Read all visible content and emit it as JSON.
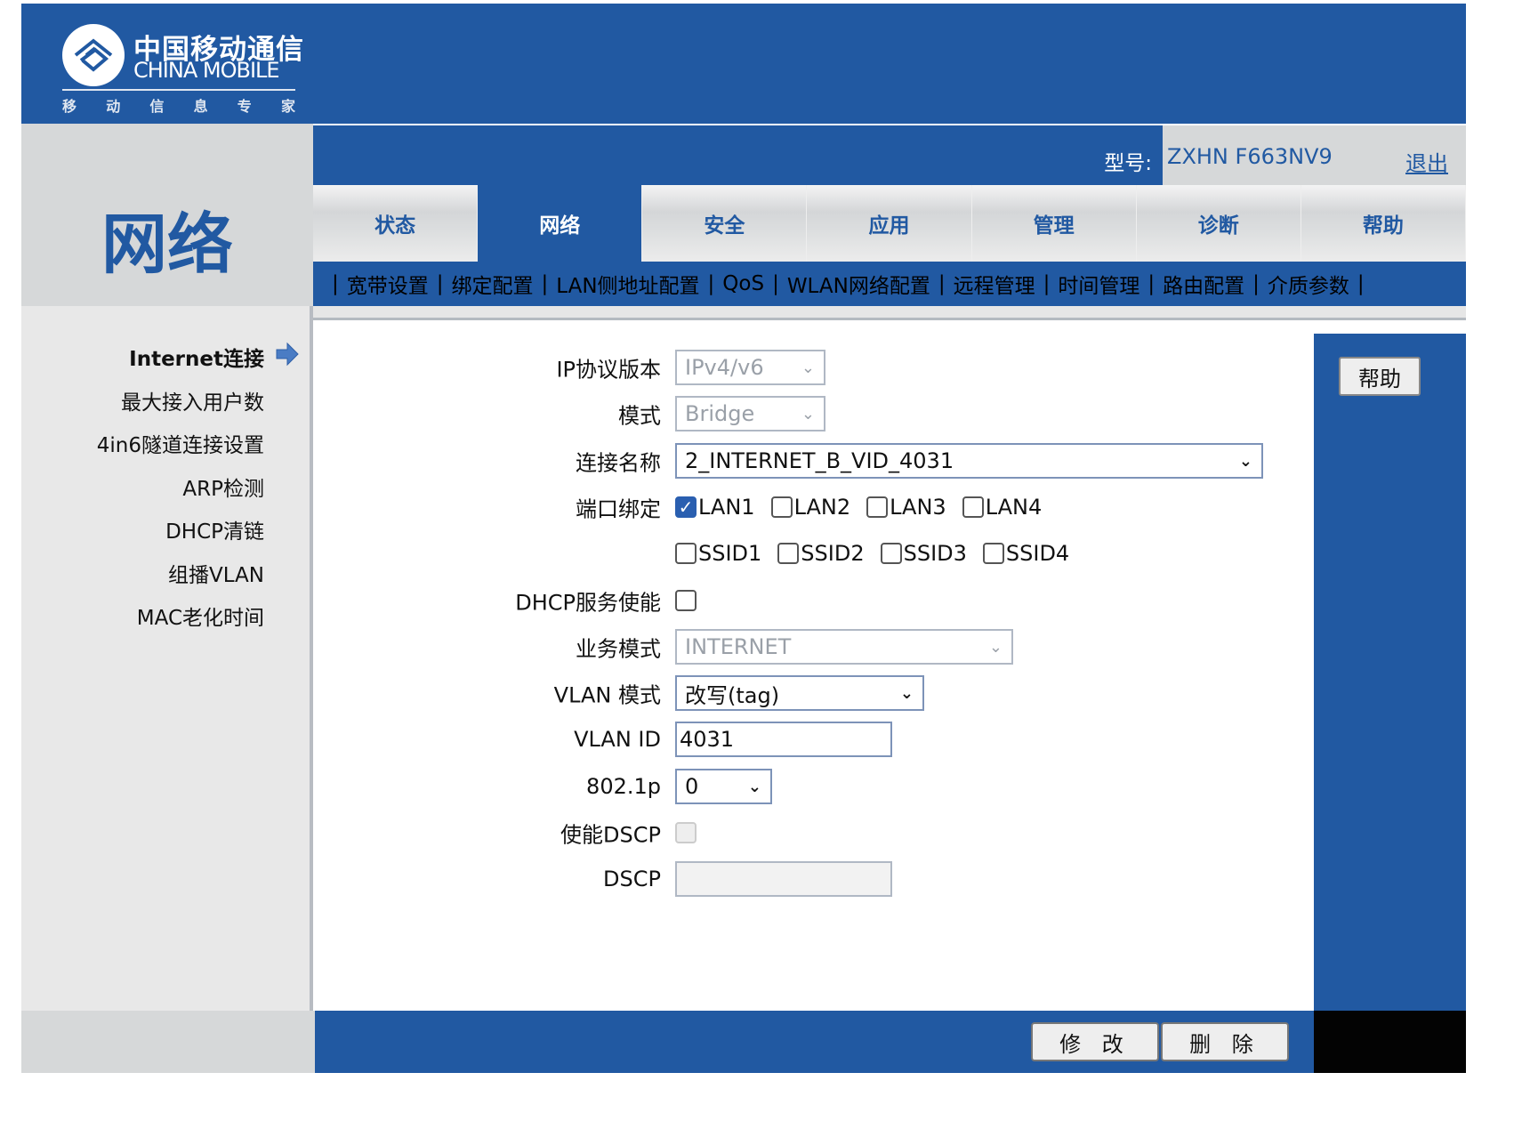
{
  "logo": {
    "cn": "中国移动通信",
    "en": "CHINA MOBILE",
    "slogan": [
      "移",
      "动",
      "信",
      "息",
      "专",
      "家"
    ]
  },
  "section_title": "网络",
  "header": {
    "model_label": "型号:",
    "model_value": "ZXHN F663NV9",
    "logout": "退出"
  },
  "tabs": [
    {
      "label": "状态"
    },
    {
      "label": "网络",
      "active": true
    },
    {
      "label": "安全"
    },
    {
      "label": "应用"
    },
    {
      "label": "管理"
    },
    {
      "label": "诊断"
    },
    {
      "label": "帮助"
    }
  ],
  "subnav": [
    "宽带设置",
    "绑定配置",
    "LAN侧地址配置",
    "QoS",
    "WLAN网络配置",
    "远程管理",
    "时间管理",
    "路由配置",
    "介质参数"
  ],
  "sidebar": {
    "items": [
      {
        "label": "Internet连接",
        "active": true
      },
      {
        "label": "最大接入用户数"
      },
      {
        "label": "4in6隧道连接设置"
      },
      {
        "label": "ARP检测"
      },
      {
        "label": "DHCP清链"
      },
      {
        "label": "组播VLAN"
      },
      {
        "label": "MAC老化时间"
      }
    ]
  },
  "form": {
    "ip_version": {
      "label": "IP协议版本",
      "value": "IPv4/v6",
      "disabled": true
    },
    "mode": {
      "label": "模式",
      "value": "Bridge",
      "disabled": true
    },
    "conn_name": {
      "label": "连接名称",
      "value": "2_INTERNET_B_VID_4031"
    },
    "port_bind": {
      "label": "端口绑定",
      "lan": [
        {
          "label": "LAN1",
          "checked": true
        },
        {
          "label": "LAN2",
          "checked": false
        },
        {
          "label": "LAN3",
          "checked": false
        },
        {
          "label": "LAN4",
          "checked": false
        }
      ],
      "ssid": [
        {
          "label": "SSID1",
          "checked": false
        },
        {
          "label": "SSID2",
          "checked": false
        },
        {
          "label": "SSID3",
          "checked": false
        },
        {
          "label": "SSID4",
          "checked": false
        }
      ]
    },
    "dhcp": {
      "label": "DHCP服务使能",
      "checked": false
    },
    "service_mode": {
      "label": "业务模式",
      "value": "INTERNET",
      "disabled": true
    },
    "vlan_mode": {
      "label": "VLAN 模式",
      "value": "改写(tag)"
    },
    "vlan_id": {
      "label": "VLAN ID",
      "value": "4031"
    },
    "p8021": {
      "label": "802.1p",
      "value": "0"
    },
    "dscp_enable": {
      "label": "使能DSCP",
      "checked": false,
      "disabled": true
    },
    "dscp": {
      "label": "DSCP",
      "value": "",
      "disabled": true
    }
  },
  "help_button": "帮助",
  "footer": {
    "modify": "修 改",
    "delete": "删 除"
  },
  "colors": {
    "brand_blue": "#2159a2",
    "panel_gray": "#d6d8d9"
  }
}
